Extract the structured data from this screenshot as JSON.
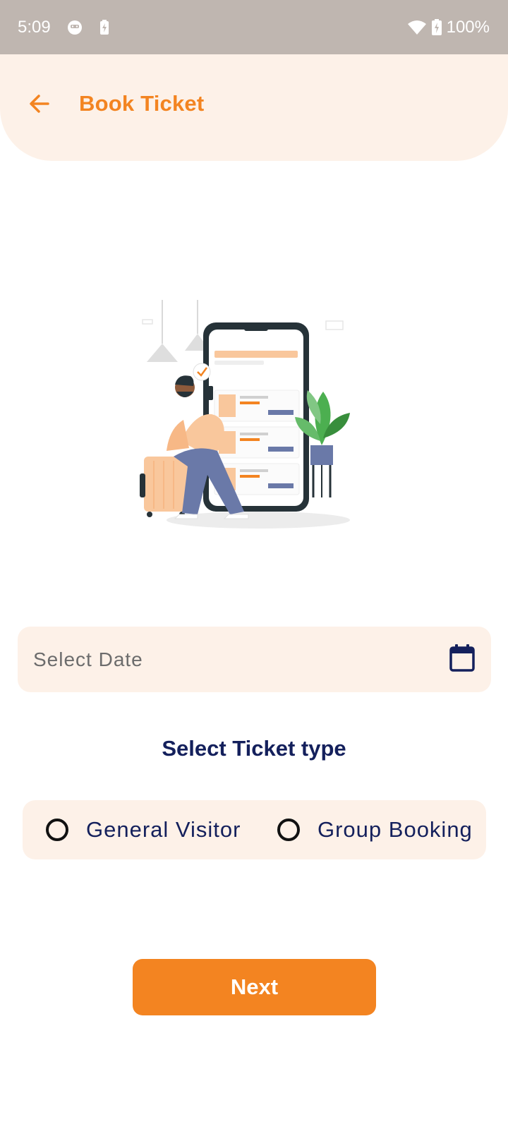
{
  "status_bar": {
    "time": "5:09",
    "battery": "100%",
    "icons": [
      "face-notification-icon",
      "battery-saver-icon",
      "wifi-icon",
      "battery-charging-icon"
    ]
  },
  "header": {
    "title": "Book Ticket",
    "back_icon": "arrow-left-icon"
  },
  "date_field": {
    "placeholder": "Select Date",
    "icon": "calendar-icon"
  },
  "ticket_type": {
    "title": "Select Ticket type",
    "options": [
      {
        "label": "General Visitor",
        "selected": false
      },
      {
        "label": "Group Booking",
        "selected": false
      }
    ]
  },
  "actions": {
    "next_label": "Next"
  },
  "colors": {
    "accent": "#f38421",
    "header_bg": "#fdf1e8",
    "navy": "#14205c",
    "status_bar_bg": "#bfb6b0"
  }
}
